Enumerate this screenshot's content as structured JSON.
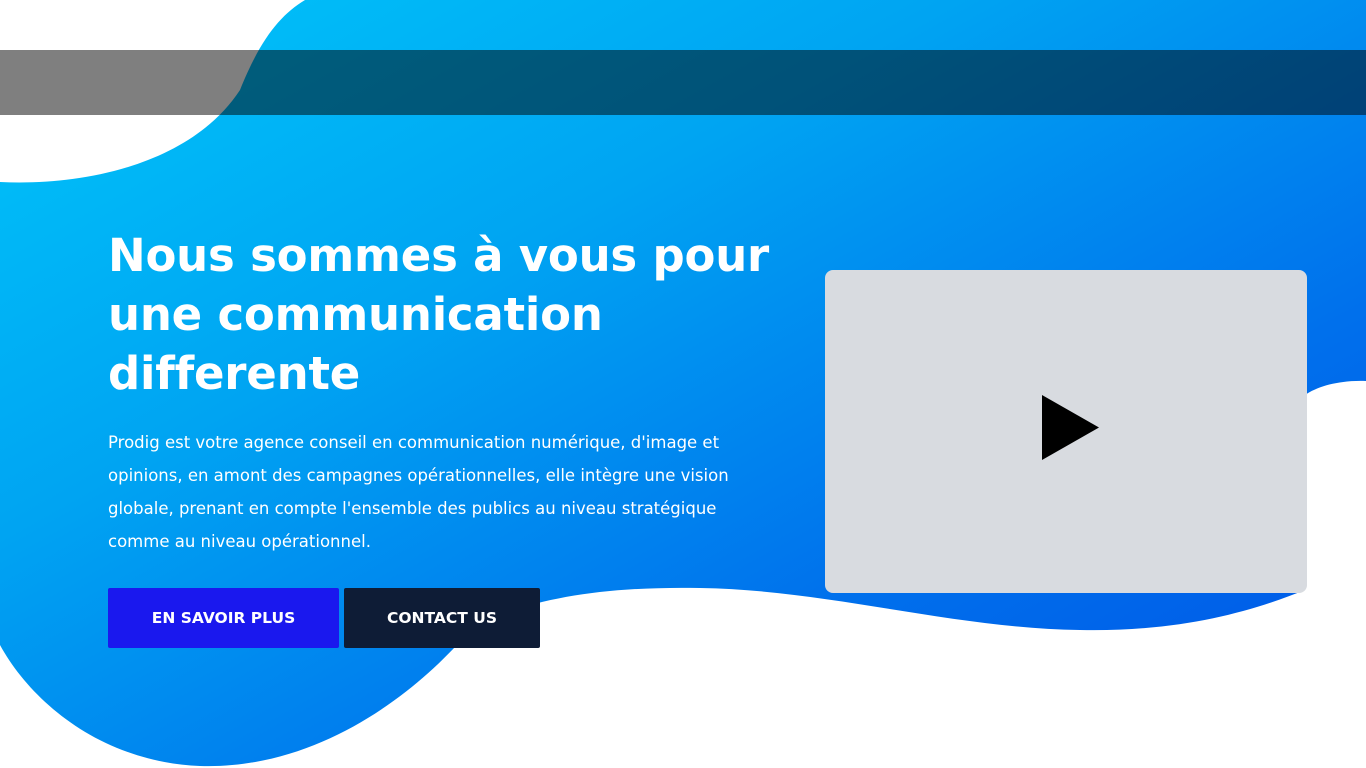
{
  "hero": {
    "title": "Nous sommes à vous pour une communication differente",
    "description": "Prodig est votre agence conseil en communication numérique, d'image et opinions, en amont des campagnes opérationnelles, elle intègre une vision globale, prenant en compte l'ensemble des publics au niveau stratégique comme au niveau opérationnel.",
    "primary_button": "EN SAVOIR PLUS",
    "secondary_button": "CONTACT US"
  },
  "video": {
    "icon": "play-icon"
  },
  "colors": {
    "gradient_light": "#00c0f8",
    "gradient_dark": "#005be8",
    "primary_button": "#1a18ee",
    "secondary_button": "#0e1c36",
    "video_placeholder": "#d8dbe0",
    "header_overlay": "rgba(0,0,0,0.5)"
  }
}
